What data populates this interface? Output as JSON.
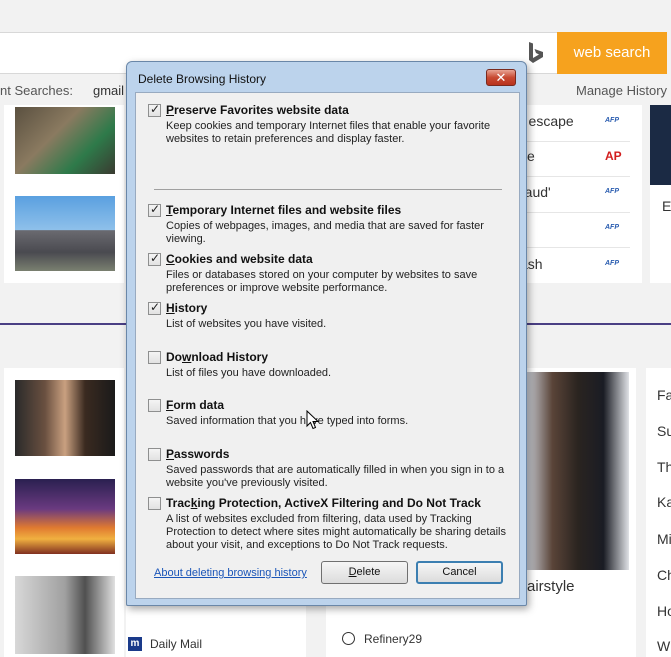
{
  "browser": {
    "web_search_label": "web search",
    "trending_label": "nt Searches:",
    "trending_term": "gmail",
    "manage_history": "Manage History"
  },
  "news": {
    "items": [
      {
        "text": "r escape",
        "source": "AFP"
      },
      {
        "text": "se",
        "source": "AP"
      },
      {
        "text": "raud'",
        "source": "AFP"
      },
      {
        "text": "",
        "source": "AFP"
      },
      {
        "text": "ash",
        "source": "AFP"
      }
    ],
    "side_letter": "E",
    "right_list": [
      "Fa",
      "Su",
      "Th",
      "Ka",
      "Mi",
      "Ch",
      "Ho",
      "W"
    ],
    "story_fragment": "airstyle",
    "source_daily_mail": "Daily Mail",
    "source_refinery": "Refinery29"
  },
  "dialog": {
    "title": "Delete Browsing History",
    "close_label": "✕",
    "options": [
      {
        "title_key": "P",
        "title_rest": "reserve Favorites website data",
        "checked": true,
        "desc": "Keep cookies and temporary Internet files that enable your favorite websites to retain preferences and display faster."
      },
      {
        "title_key": "T",
        "title_rest": "emporary Internet files and website files",
        "checked": true,
        "desc": "Copies of webpages, images, and media that are saved for faster viewing."
      },
      {
        "title_key": "C",
        "title_rest": "ookies and website data",
        "checked": true,
        "desc": "Files or databases stored on your computer by websites to save preferences or improve website performance."
      },
      {
        "title_key": "H",
        "title_rest": "istory",
        "checked": true,
        "desc": "List of websites you have visited."
      },
      {
        "title_pre": "Do",
        "title_key": "w",
        "title_rest": "nload History",
        "checked": false,
        "desc": "List of files you have downloaded."
      },
      {
        "title_key": "F",
        "title_rest": "orm data",
        "checked": false,
        "desc": "Saved information that you have typed into forms."
      },
      {
        "title_key": "P",
        "title_rest": "asswords",
        "checked": false,
        "desc": "Saved passwords that are automatically filled in when you sign in to a website you've previously visited."
      },
      {
        "title_pre": "Trac",
        "title_key": "k",
        "title_rest": "ing Protection, ActiveX Filtering and Do Not Track",
        "checked": false,
        "desc": "A list of websites excluded from filtering, data used by Tracking Protection to detect where sites might automatically be sharing details about your visit, and exceptions to Do Not Track requests."
      }
    ],
    "about_link": "About deleting browsing history",
    "delete_key": "D",
    "delete_rest": "elete",
    "cancel_label": "Cancel"
  },
  "colors": {
    "accent_orange": "#f6a21e",
    "brand_purple": "#4a3f84",
    "link_blue": "#1a55b8"
  }
}
